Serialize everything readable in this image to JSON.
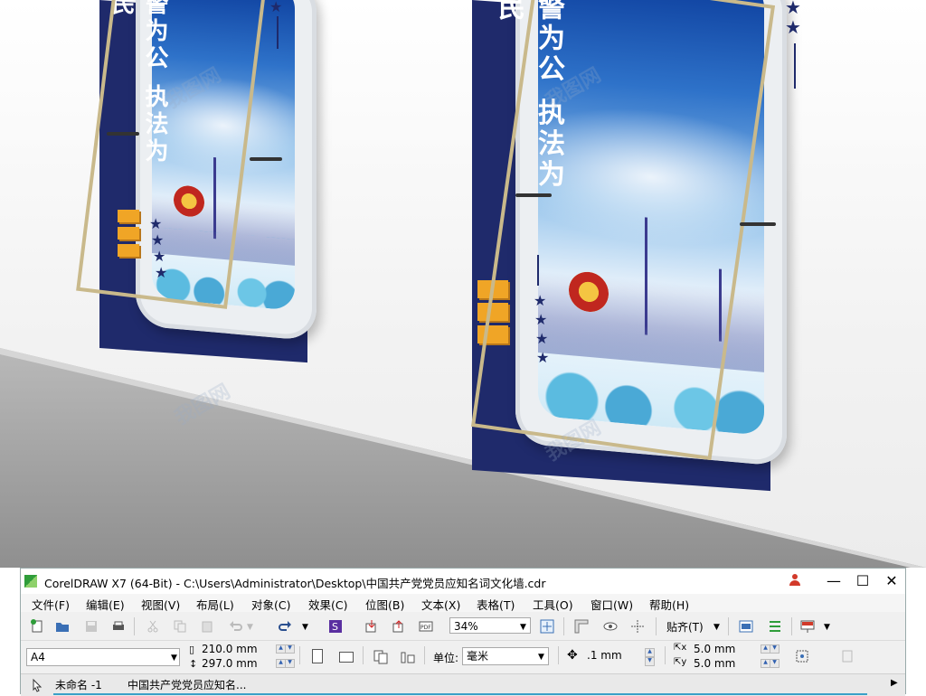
{
  "render": {
    "board_left": {
      "slogan": "警为公 执法为民",
      "stars": 4
    },
    "board_right": {
      "slogan": "警为公 执法为民",
      "stars": 6
    },
    "watermark": "我图网"
  },
  "window": {
    "title": "CorelDRAW X7 (64-Bit) - C:\\Users\\Administrator\\Desktop\\中国共产党党员应知名词文化墙.cdr",
    "controls": {
      "minimize": "—",
      "maximize": "☐",
      "close": "✕"
    }
  },
  "menu": [
    "文件(F)",
    "编辑(E)",
    "视图(V)",
    "布局(L)",
    "对象(C)",
    "效果(C)",
    "位图(B)",
    "文本(X)",
    "表格(T)",
    "工具(O)",
    "窗口(W)",
    "帮助(H)"
  ],
  "toolbar": {
    "zoom": "34%",
    "snap_label": "贴齐(T)"
  },
  "property_bar": {
    "page_size": "A4",
    "width": "210.0 mm",
    "height": "297.0 mm",
    "units_label": "单位:",
    "units_value": "毫米",
    "nudge": ".1 mm",
    "dup_x": "5.0 mm",
    "dup_y": "5.0 mm"
  },
  "tabs": {
    "untitled": "未命名 -1",
    "document": "中国共产党党员应知名..."
  },
  "colors": {
    "navy": "#1f2a6b",
    "gold_frame": "#c9b98b",
    "accent_orange": "#f0a526",
    "app_logo_green": "#2f9d3a"
  }
}
